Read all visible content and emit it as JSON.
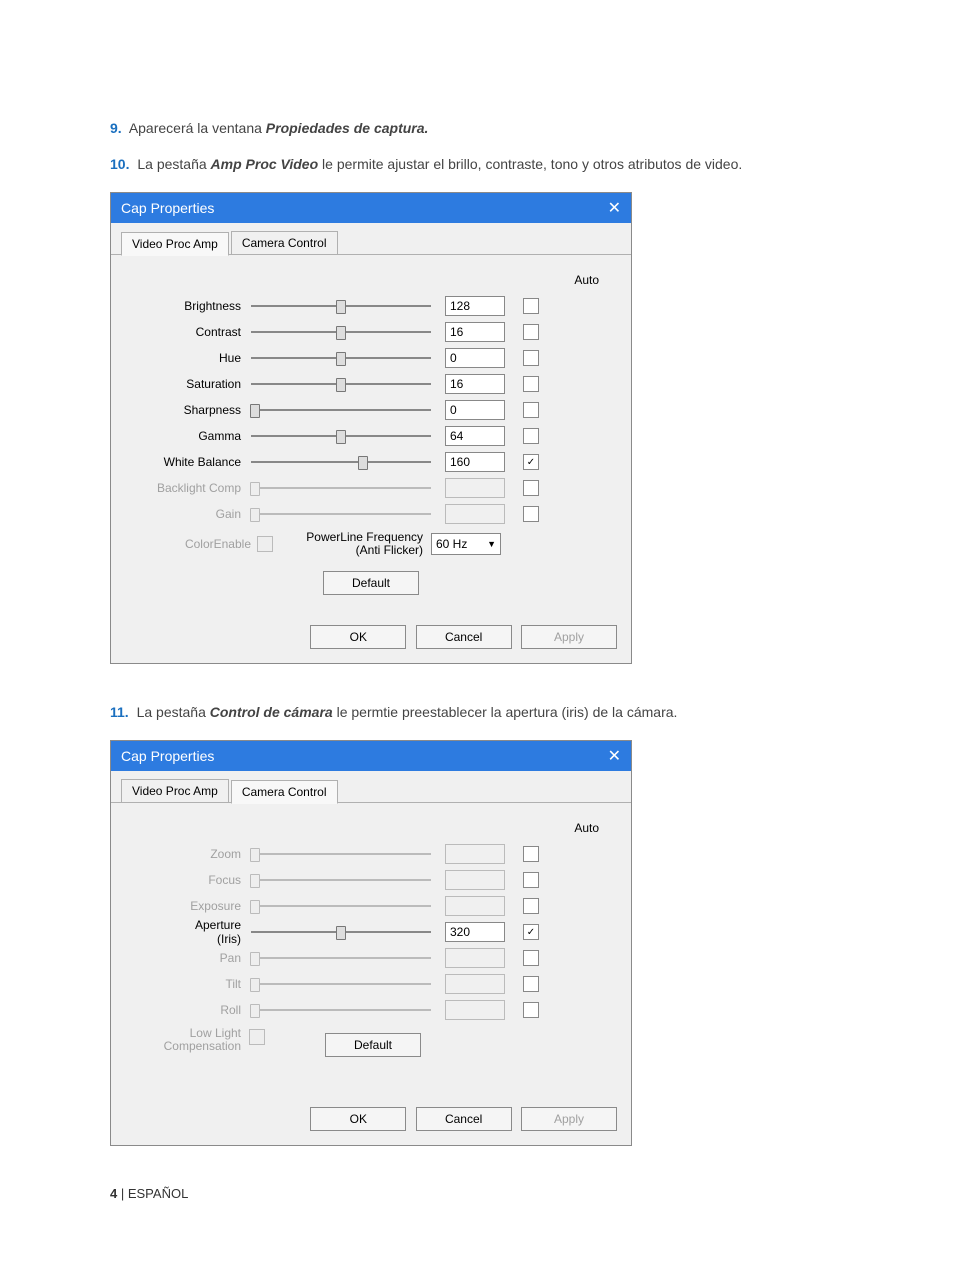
{
  "intro": {
    "line9_num": "9.",
    "line9_a": "Aparecerá la ventana ",
    "line9_b": "Propiedades de captura.",
    "line10_num": "10.",
    "line10_a": "La pestaña ",
    "line10_b": "Amp Proc Video",
    "line10_c": " le permite ajustar el brillo, contraste, tono y otros atributos de video.",
    "line11_num": "11.",
    "line11_a": "La pestaña ",
    "line11_b": "Control de cámara",
    "line11_c": " le permtie preestablecer la apertura (iris) de la cámara."
  },
  "dialog1": {
    "title": "Cap Properties",
    "close": "✕",
    "tab1": "Video Proc Amp",
    "tab2": "Camera Control",
    "auto_header": "Auto",
    "rows": [
      {
        "label": "Brightness",
        "value": "128",
        "pos": 50,
        "auto": false,
        "disabled": false,
        "hasval": true
      },
      {
        "label": "Contrast",
        "value": "16",
        "pos": 50,
        "auto": false,
        "disabled": false,
        "hasval": true
      },
      {
        "label": "Hue",
        "value": "0",
        "pos": 50,
        "auto": false,
        "disabled": false,
        "hasval": true
      },
      {
        "label": "Saturation",
        "value": "16",
        "pos": 50,
        "auto": false,
        "disabled": false,
        "hasval": true
      },
      {
        "label": "Sharpness",
        "value": "0",
        "pos": 2,
        "auto": false,
        "disabled": false,
        "hasval": true
      },
      {
        "label": "Gamma",
        "value": "64",
        "pos": 50,
        "auto": false,
        "disabled": false,
        "hasval": true
      },
      {
        "label": "White Balance",
        "value": "160",
        "pos": 62,
        "auto": true,
        "disabled": false,
        "hasval": true
      },
      {
        "label": "Backlight Comp",
        "value": "",
        "pos": 2,
        "auto": false,
        "disabled": true,
        "hasval": false
      },
      {
        "label": "Gain",
        "value": "",
        "pos": 2,
        "auto": false,
        "disabled": true,
        "hasval": false
      }
    ],
    "colorenable_label": "ColorEnable",
    "powerline_label1": "PowerLine Frequency",
    "powerline_label2": "(Anti Flicker)",
    "powerline_value": "60 Hz",
    "default_btn": "Default",
    "ok": "OK",
    "cancel": "Cancel",
    "apply": "Apply"
  },
  "dialog2": {
    "title": "Cap Properties",
    "close": "✕",
    "tab1": "Video Proc Amp",
    "tab2": "Camera Control",
    "auto_header": "Auto",
    "rows": [
      {
        "label": "Zoom",
        "value": "",
        "pos": 2,
        "auto": false,
        "disabled": true,
        "hasval": false
      },
      {
        "label": "Focus",
        "value": "",
        "pos": 2,
        "auto": false,
        "disabled": true,
        "hasval": false
      },
      {
        "label": "Exposure",
        "value": "",
        "pos": 2,
        "auto": false,
        "disabled": true,
        "hasval": false
      },
      {
        "label": "Aperture\n(Iris)",
        "value": "320",
        "pos": 50,
        "auto": true,
        "disabled": false,
        "hasval": true
      },
      {
        "label": "Pan",
        "value": "",
        "pos": 2,
        "auto": false,
        "disabled": true,
        "hasval": false
      },
      {
        "label": "Tilt",
        "value": "",
        "pos": 2,
        "auto": false,
        "disabled": true,
        "hasval": false
      },
      {
        "label": "Roll",
        "value": "",
        "pos": 2,
        "auto": false,
        "disabled": true,
        "hasval": false
      }
    ],
    "lowlight_label1": "Low Light",
    "lowlight_label2": "Compensation",
    "default_btn": "Default",
    "ok": "OK",
    "cancel": "Cancel",
    "apply": "Apply"
  },
  "footer": {
    "page": "4",
    "sep": " | ",
    "lang": "ESPAÑOL"
  }
}
